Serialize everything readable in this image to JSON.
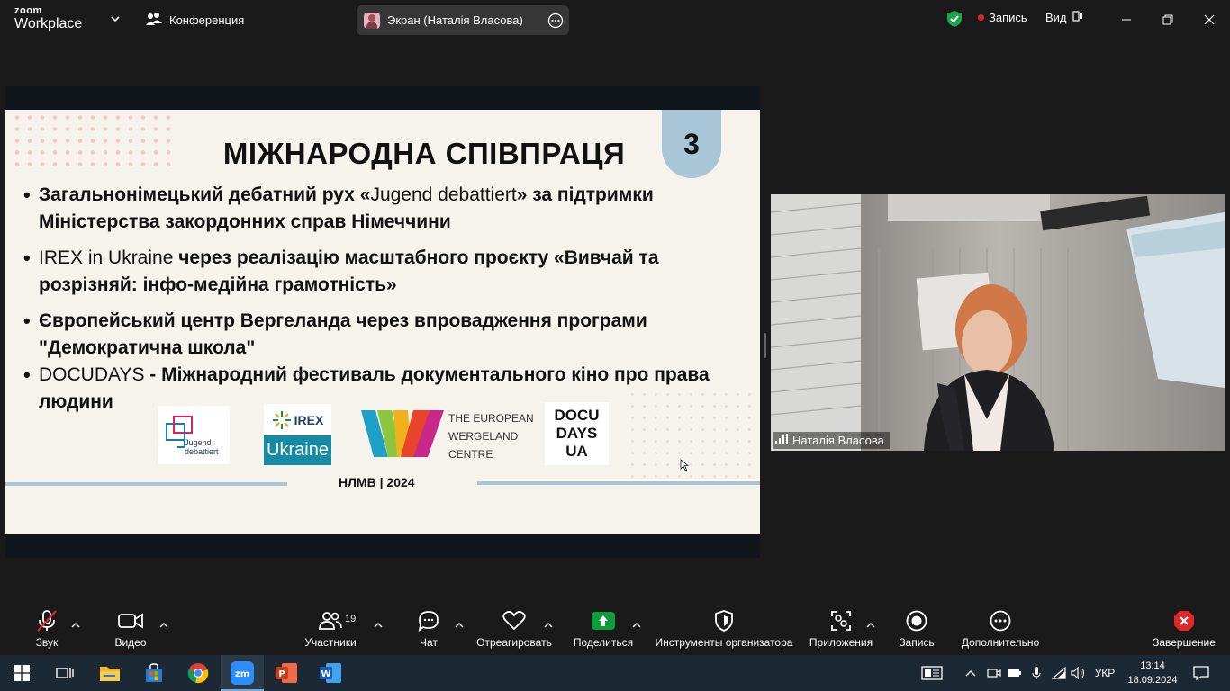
{
  "titlebar": {
    "logo_top": "zoom",
    "logo_bottom": "Workplace",
    "conference_label": "Конференция",
    "screen_pill_label": "Экран (Наталія Власова)",
    "recording_label": "Запись",
    "view_label": "Вид"
  },
  "slide": {
    "page_number": "3",
    "title": "МІЖНАРОДНА СПІВПРАЦЯ",
    "bullets": [
      {
        "a": "Загальнонімецький дебатний рух  «",
        "b": "Jugend debattiert",
        "c": "» за підтримки Міністерства закордонних справ Німеччини"
      },
      {
        "a": "",
        "b": "IREX in Ukraine",
        "c": " через реалізацію масштабного проєкту «Вивчай та розрізняй: інфо-медійна грамотність»"
      },
      {
        "a": "Європейський центр Вергеланда через впровадження програми \"Демократична школа\"",
        "b": "",
        "c": ""
      },
      {
        "a": "",
        "b": "DOCUDAYS",
        "c": " - Міжнародний фестиваль документального кіно про права людини"
      }
    ],
    "logos": {
      "jugend_line1": "Jugend",
      "jugend_line2": "debattiert",
      "irex_top": "IREX",
      "irex_bottom": "Ukraine",
      "ewc_line1": "THE EUROPEAN",
      "ewc_line2": "WERGELAND",
      "ewc_line3": "CENTRE",
      "docu_line1": "DOCU",
      "docu_line2": "DAYS",
      "docu_line3": "UA"
    },
    "footer": "НЛМВ | 2024",
    "tab_color": "#a8c6d8"
  },
  "participant": {
    "name": "Наталія Власова"
  },
  "toolbar": {
    "items": [
      {
        "label": "Звук",
        "icon": "microphone-muted-icon"
      },
      {
        "label": "Видео",
        "icon": "video-camera-icon"
      },
      {
        "label": "Участники",
        "icon": "participants-icon",
        "count": "19"
      },
      {
        "label": "Чат",
        "icon": "chat-icon"
      },
      {
        "label": "Отреагировать",
        "icon": "heart-icon"
      },
      {
        "label": "Поделиться",
        "icon": "share-screen-icon"
      },
      {
        "label": "Инструменты организатора",
        "icon": "shield-icon"
      },
      {
        "label": "Приложения",
        "icon": "apps-icon"
      },
      {
        "label": "Запись",
        "icon": "record-icon"
      },
      {
        "label": "Дополнительно",
        "icon": "more-icon"
      },
      {
        "label": "Завершение",
        "icon": "end-meeting-icon"
      }
    ],
    "share_color": "#0e9c3c",
    "end_color": "#e02828"
  },
  "taskbar": {
    "language": "УКР",
    "time": "13:14",
    "date": "18.09.2024",
    "apps": [
      "windows-start-icon",
      "task-view-icon",
      "file-explorer-icon",
      "microsoft-store-icon",
      "chrome-icon",
      "zoom-icon",
      "powerpoint-icon",
      "word-icon"
    ]
  }
}
